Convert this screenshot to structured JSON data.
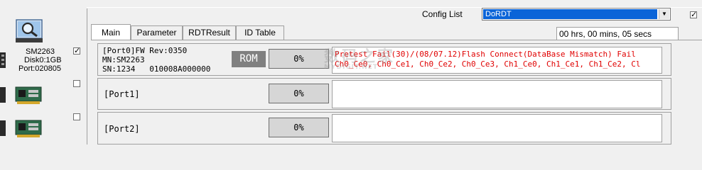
{
  "sidebar": {
    "device": {
      "model": "SM2263",
      "disk": "Disk0:1GB",
      "port": "Port:020805",
      "checked": true
    },
    "slots": [
      {
        "checked": false
      },
      {
        "checked": false
      }
    ]
  },
  "config": {
    "label": "Config List",
    "selected": "DoRDT",
    "enabled_checked": true
  },
  "tabs": [
    {
      "label": "Main",
      "active": true
    },
    {
      "label": "Parameter",
      "active": false
    },
    {
      "label": "RDTResult",
      "active": false
    },
    {
      "label": "ID Table",
      "active": false
    }
  ],
  "timer": "00 hrs, 00 mins, 05 secs",
  "ports": [
    {
      "info_line1": "[Port0]FW Rev:0350",
      "info_line2": "MN:SM2263",
      "info_line3": "SN:1234   010008A000000",
      "mode_badge": "ROM",
      "progress": "0%",
      "message_line1": "Pretest Fail(30)/(08/07.12)Flash Connect(DataBase Mismatch) Fail",
      "message_line2": "Ch0_Ce0, Ch0_Ce1, Ch0_Ce2, Ch0_Ce3, Ch1_Ce0, Ch1_Ce1, Ch1_Ce2, Cl"
    },
    {
      "label": "[Port1]",
      "progress": "0%"
    },
    {
      "label": "[Port2]",
      "progress": "0%"
    }
  ],
  "watermark": {
    "text": "数码之家",
    "sub": "MYDIGIT.NET"
  },
  "colors": {
    "selection": "#0a64d8",
    "error_text": "#e00000",
    "rom_badge": "#808080",
    "progress_bg": "#d6d6d6"
  }
}
